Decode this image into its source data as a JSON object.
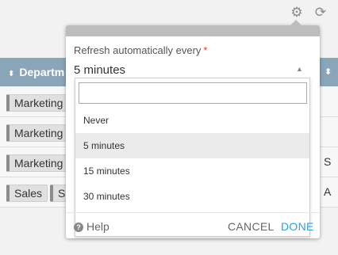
{
  "toolbar": {
    "settings_icon": "gear-icon",
    "refresh_icon": "refresh-icon"
  },
  "table": {
    "header_dept": "Departm",
    "rows": [
      {
        "tags": [
          "Marketing"
        ],
        "tail": ""
      },
      {
        "tags": [
          "Marketing"
        ],
        "tail": ""
      },
      {
        "tags": [
          "Marketing"
        ],
        "tail": "S"
      },
      {
        "tags": [
          "Sales",
          "Su"
        ],
        "tail": "A"
      }
    ]
  },
  "popup": {
    "label": "Refresh automatically every",
    "required_mark": "*",
    "selected_value": "5 minutes",
    "search_placeholder": "",
    "options": [
      "Never",
      "5 minutes",
      "15 minutes",
      "30 minutes"
    ],
    "highlighted_option": "5 minutes",
    "help_label": "Help",
    "cancel_label": "CANCEL",
    "done_label": "DONE"
  },
  "colors": {
    "header_bg": "#8aa4b8",
    "accent": "#2aa3d6",
    "required": "#d9342b"
  }
}
